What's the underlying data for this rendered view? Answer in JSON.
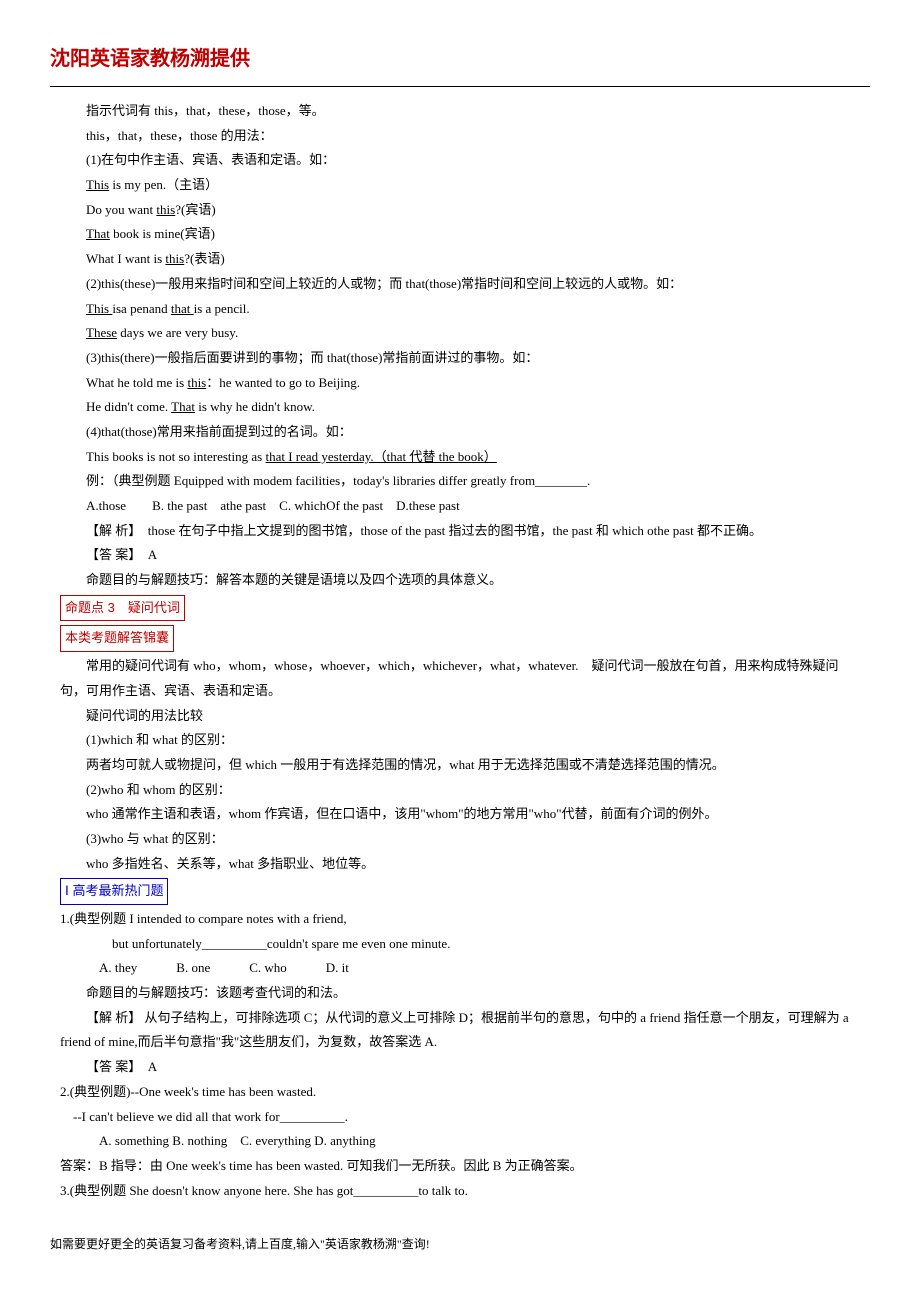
{
  "header": "沈阳英语家教杨溯提供",
  "p1": "指示代词有 this，that，these，those，等。",
  "p2": "this，that，these，those 的用法：",
  "p3": "(1)在句中作主语、宾语、表语和定语。如：",
  "p4a": "This",
  "p4b": " is my pen.（主语）",
  "p5a": "Do you want ",
  "p5b": "this",
  "p5c": "?(宾语)",
  "p6a": "That",
  "p6b": " book is mine(宾语)",
  "p7a": "What I want is ",
  "p7b": "this",
  "p7c": "?(表语)",
  "p8": "(2)this(these)一般用来指时间和空间上较近的人或物；而 that(those)常指时间和空间上较远的人或物。如：",
  "p9a": "This ",
  "p9b": "isa penand ",
  "p9c": "that ",
  "p9d": "is a pencil.",
  "p10a": "These",
  "p10b": " days we are very busy.",
  "p11": "(3)this(there)一般指后面要讲到的事物；而 that(those)常指前面讲过的事物。如：",
  "p12a": "What he told me is ",
  "p12b": "this",
  "p12c": "：he wanted to go to Beijing.",
  "p13a": "He didn't come. ",
  "p13b": "That",
  "p13c": " is why he didn't know.",
  "p14": "(4)that(those)常用来指前面提到过的名词。如：",
  "p15a": "This books is not so interesting as ",
  "p15b": "that I read yesterday.（that 代替 the book）",
  "p16": "例：（典型例题 Equipped with modem facilities，today's libraries differ greatly from________.",
  "p17": "A.those　　B. the past　athe past　C. whichOf the past　D.these past",
  "p18": "【解 析】　those 在句子中指上文提到的图书馆，those of the past 指过去的图书馆，the past 和 which othe past 都不正确。",
  "p19": "【答 案】　A",
  "p20": "命题目的与解题技巧：解答本题的关键是语境以及四个选项的具体意义。",
  "box1": "命题点 3　疑问代词",
  "box2": "本类考题解答锦囊",
  "p21": "常用的疑问代词有 who，whom，whose，whoever，which，whichever，what，whatever.　疑问代词一般放在句首，用来构成特殊疑问句，可用作主语、宾语、表语和定语。",
  "p22": "疑问代词的用法比较",
  "p23": "(1)which 和 what 的区别：",
  "p24": "两者均可就人或物提问，但 which 一般用于有选择范围的情况，what 用于无选择范围或不清楚选择范围的情况。",
  "p25": "(2)who 和 whom 的区别：",
  "p26": "who 通常作主语和表语，whom 作宾语，但在口语中，该用\"whom\"的地方常用\"who\"代替，前面有介词的例外。",
  "p27": "(3)who 与 what 的区别：",
  "p28": "who 多指姓名、关系等，what 多指职业、地位等。",
  "box3": "Ⅰ 高考最新热门题",
  "q1a": " 1.(典型例题 I intended to compare notes with a friend,",
  "q1b": "but unfortunately__________couldn't spare me even one minute.",
  "q1opts": "A. they　　　B. one　　　C. who　　　D. it",
  "q1c": "命题目的与解题技巧：该题考查代词的和法。",
  "q1d": "【解 析】 从句子结构上，可排除选项 C；从代词的意义上可排除 D；根据前半句的意思，句中的 a friend 指任意一个朋友，可理解为 a friend of mine,而后半句意指\"我\"这些朋友们，为复数，故答案选 A.",
  "q1e": "【答 案】　A",
  "q2a": "2.(典型例题)--One week's time has been wasted.",
  "q2b": "--I can't believe we did all that work for__________.",
  "q2opts": "A. something B. nothing　C. everything D. anything",
  "q2c": "答案：B 指导：由 One week's time has been wasted. 可知我们一无所获。因此 B 为正确答案。",
  "q3": "3.(典型例题 She doesn't know anyone here. She has got__________to talk to.",
  "footer": "如需要更好更全的英语复习备考资料,请上百度,输入\"英语家教杨溯\"查询!"
}
